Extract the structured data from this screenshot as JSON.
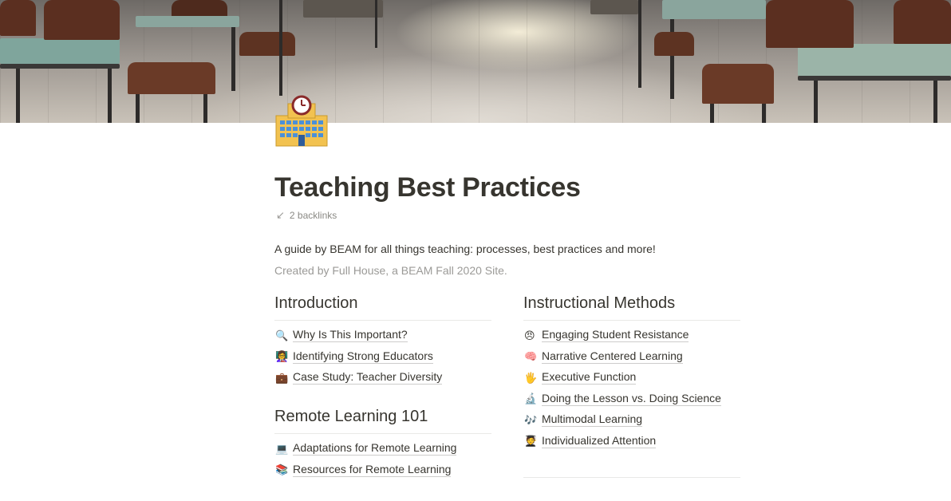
{
  "page": {
    "title": "Teaching Best Practices",
    "backlinks": "2 backlinks",
    "description": "A guide by BEAM for all things teaching: processes, best practices and more!",
    "created": "Created by Full House, a BEAM Fall 2020 Site."
  },
  "icons": {
    "page_icon": "school-building-icon",
    "backlinks_icon": "arrow-down-left-icon"
  },
  "colors": {
    "text": "#37352f",
    "muted": "#9b9a97",
    "rule": "#e9e9e7"
  },
  "sections": {
    "introduction": {
      "heading": "Introduction",
      "links": [
        {
          "icon": "🔍",
          "icon_name": "magnifying-glass-icon",
          "label": "Why Is This Important?"
        },
        {
          "icon": "👩‍🏫",
          "icon_name": "teacher-icon",
          "label": "Identifying Strong Educators"
        },
        {
          "icon": "💼",
          "icon_name": "briefcase-icon",
          "label": "Case Study: Teacher Diversity"
        }
      ]
    },
    "remote": {
      "heading": "Remote Learning 101",
      "links": [
        {
          "icon": "💻",
          "icon_name": "laptop-icon",
          "label": "Adaptations for Remote Learning"
        },
        {
          "icon": "📚",
          "icon_name": "books-icon",
          "label": "Resources for Remote Learning"
        }
      ]
    },
    "instructional": {
      "heading": "Instructional Methods",
      "links": [
        {
          "icon": "😠",
          "icon_name": "angry-face-icon",
          "label": "Engaging Student Resistance"
        },
        {
          "icon": "🧠",
          "icon_name": "brain-icon",
          "label": "Narrative Centered Learning"
        },
        {
          "icon": "🖐",
          "icon_name": "raised-hand-icon",
          "label": "Executive Function"
        },
        {
          "icon": "🔬",
          "icon_name": "microscope-icon",
          "label": "Doing the Lesson vs. Doing Science"
        },
        {
          "icon": "🎶",
          "icon_name": "music-notes-icon",
          "label": "Multimodal Learning"
        },
        {
          "icon": "🧑‍🎓",
          "icon_name": "student-icon",
          "label": "Individualized Attention"
        }
      ]
    }
  }
}
